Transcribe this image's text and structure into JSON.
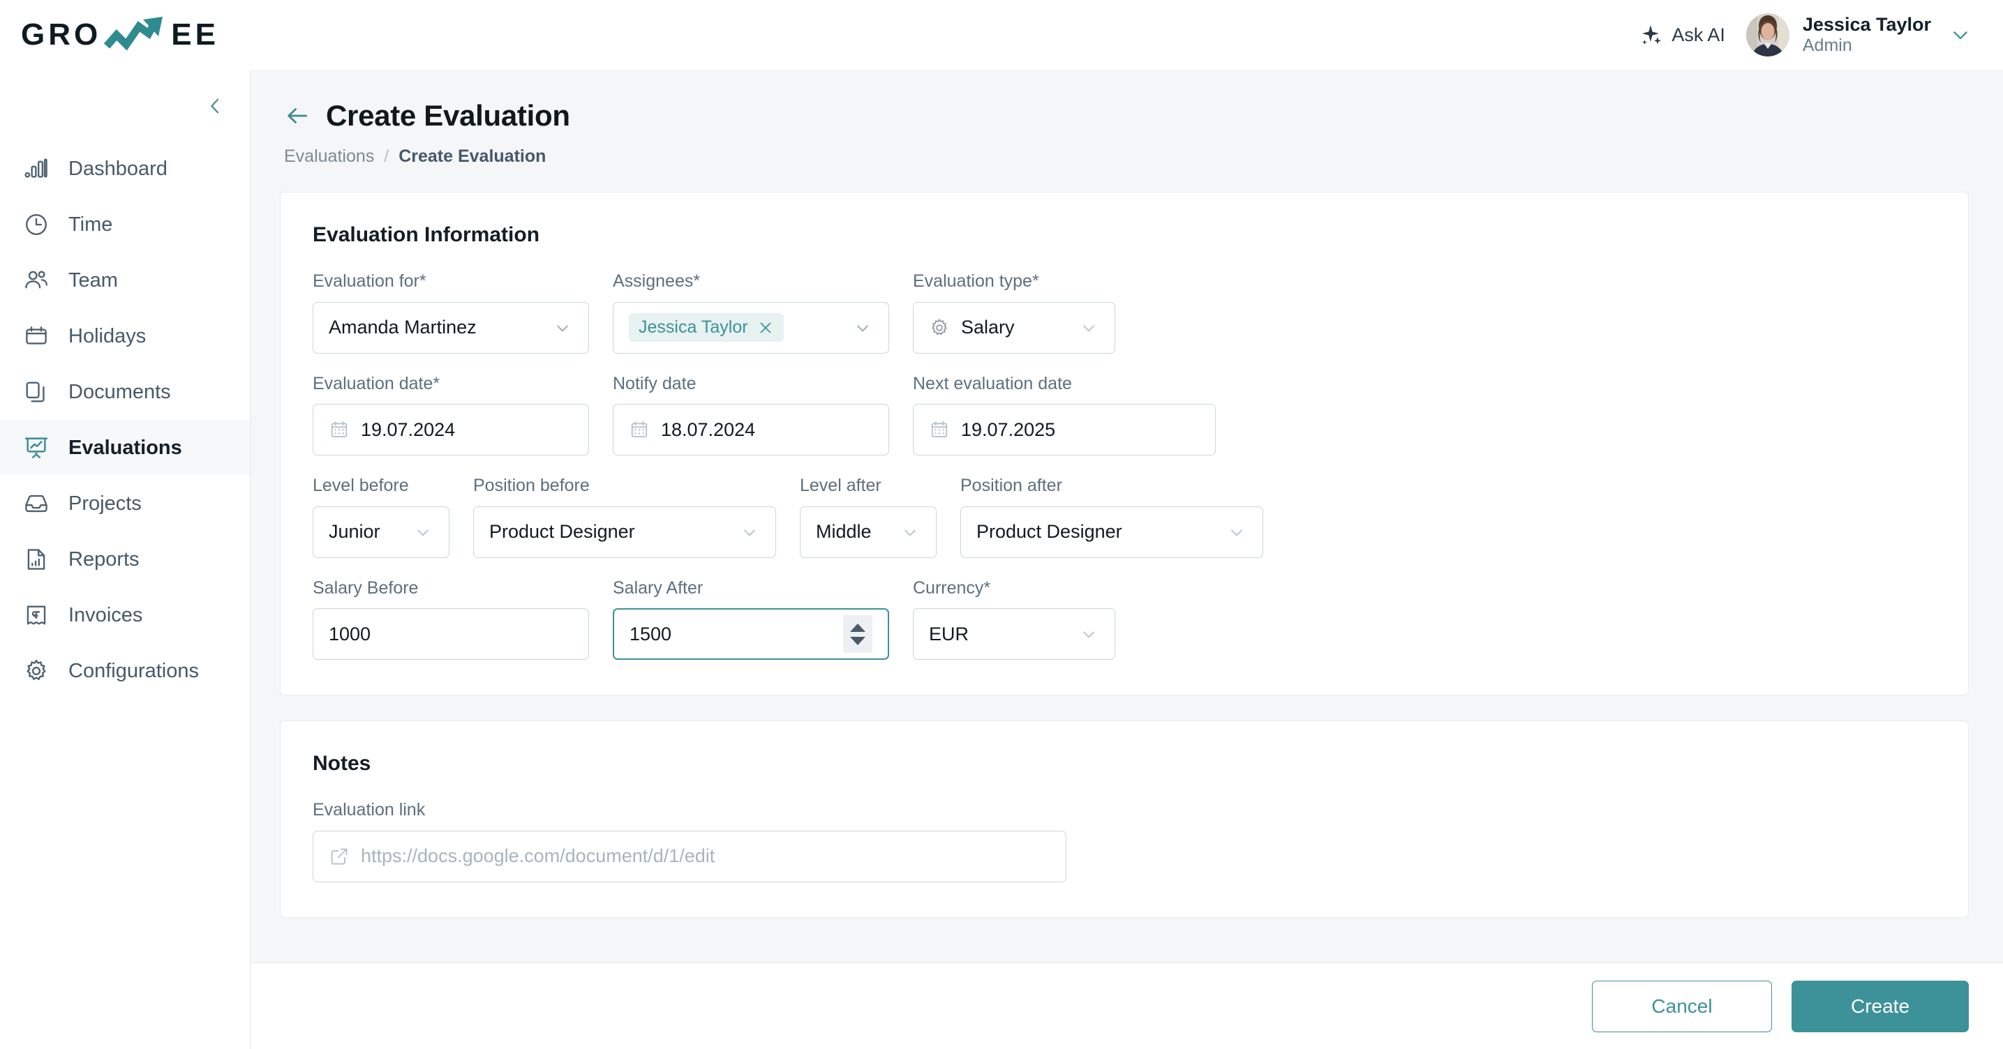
{
  "brand": {
    "logo_text_left": "GRO",
    "logo_text_right": "EE",
    "accent_color": "#3d9199"
  },
  "header": {
    "ask_ai_label": "Ask AI",
    "user_name": "Jessica Taylor",
    "user_role": "Admin"
  },
  "sidebar": {
    "items": [
      {
        "label": "Dashboard",
        "icon": "bar-chart-icon",
        "active": false
      },
      {
        "label": "Time",
        "icon": "clock-icon",
        "active": false
      },
      {
        "label": "Team",
        "icon": "users-icon",
        "active": false
      },
      {
        "label": "Holidays",
        "icon": "calendar-icon",
        "active": false
      },
      {
        "label": "Documents",
        "icon": "documents-icon",
        "active": false
      },
      {
        "label": "Evaluations",
        "icon": "presentation-chart-icon",
        "active": true
      },
      {
        "label": "Projects",
        "icon": "inbox-icon",
        "active": false
      },
      {
        "label": "Reports",
        "icon": "report-file-icon",
        "active": false
      },
      {
        "label": "Invoices",
        "icon": "invoice-icon",
        "active": false
      },
      {
        "label": "Configurations",
        "icon": "gear-icon",
        "active": false
      }
    ]
  },
  "page": {
    "title": "Create Evaluation",
    "breadcrumb": {
      "parent": "Evaluations",
      "separator": "/",
      "current": "Create Evaluation"
    }
  },
  "evaluation_information": {
    "section_title": "Evaluation Information",
    "evaluation_for": {
      "label": "Evaluation for*",
      "value": "Amanda Martinez"
    },
    "assignees": {
      "label": "Assignees*",
      "chips": [
        "Jessica Taylor"
      ]
    },
    "evaluation_type": {
      "label": "Evaluation type*",
      "value": "Salary",
      "icon": "gear-icon"
    },
    "evaluation_date": {
      "label": "Evaluation date*",
      "value": "19.07.2024",
      "icon": "calendar-icon"
    },
    "notify_date": {
      "label": "Notify date",
      "value": "18.07.2024",
      "icon": "calendar-icon"
    },
    "next_evaluation_date": {
      "label": "Next evaluation date",
      "value": "19.07.2025",
      "icon": "calendar-icon"
    },
    "level_before": {
      "label": "Level before",
      "value": "Junior"
    },
    "position_before": {
      "label": "Position before",
      "value": "Product Designer"
    },
    "level_after": {
      "label": "Level after",
      "value": "Middle"
    },
    "position_after": {
      "label": "Position after",
      "value": "Product Designer"
    },
    "salary_before": {
      "label": "Salary Before",
      "value": "1000"
    },
    "salary_after": {
      "label": "Salary After",
      "value": "1500",
      "focused": true
    },
    "currency": {
      "label": "Currency*",
      "value": "EUR"
    }
  },
  "notes": {
    "section_title": "Notes",
    "evaluation_link": {
      "label": "Evaluation link",
      "value": "",
      "placeholder": "https://docs.google.com/document/d/1/edit",
      "icon": "external-link-icon"
    }
  },
  "footer": {
    "cancel_label": "Cancel",
    "create_label": "Create"
  }
}
